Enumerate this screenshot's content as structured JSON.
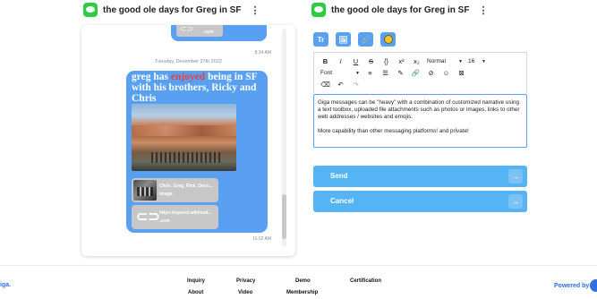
{
  "left_header": {
    "title": "the good ole days for Greg in SF",
    "menu": "⋮"
  },
  "right_header": {
    "title": "the good ole days for Greg in SF",
    "menu": "⋮"
  },
  "chat": {
    "prev_attachment": ".com",
    "prev_time": "8:34 AM",
    "date_separator": "Tuesday, December 27th 2022",
    "message_parts": [
      "greg has ",
      "enjoyed",
      " being in SF with his brothers, Ricky and Chris"
    ],
    "attachment1_name": "Chris_Greg_Rick_Dece...",
    "attachment1_type": "image",
    "attachment2_line1": "https://upsnot.wikimed...",
    "attachment2_line2": ".com",
    "time": "11:02 AM"
  },
  "editor": {
    "tool_buttons": [
      "Tr",
      "🖼",
      "🔗",
      "emoji"
    ],
    "toolbar_row1": [
      "B",
      "I",
      "U",
      "S",
      "{}",
      "x²",
      "x₂"
    ],
    "heading_select": "Normal",
    "size_select": "16",
    "font_select": "Font",
    "toolbar_row2_icons": [
      "≡",
      "☰",
      "✎",
      "🔗",
      "⊘",
      "☺",
      "⊠"
    ],
    "toolbar_row3_icons": [
      "⌫",
      "↶",
      "↷"
    ],
    "paragraph1": "Giga messages can be \"heavy\" with a combination of customized narrative using a text toolbox, uploaded file attachments such as photos or images, links to other web addresses / websites and emojis.",
    "paragraph2": "More capability than other messaging platforms! and private!"
  },
  "actions": {
    "send_label": "Send",
    "cancel_label": "Cancel",
    "arrow": "→"
  },
  "footer": {
    "brand": "iga.",
    "links": {
      "inquiry": "Inquiry",
      "about": "About",
      "privacy": "Privacy",
      "video": "Video",
      "demo": "Demo",
      "membership": "Membership",
      "certification": "Certification"
    },
    "powered_by": "Powered by"
  },
  "colors": {
    "bubble": "#5aa0f2",
    "accent": "#55b4f3",
    "brand": "#2f6fe0",
    "logo": "#2ecc40"
  }
}
